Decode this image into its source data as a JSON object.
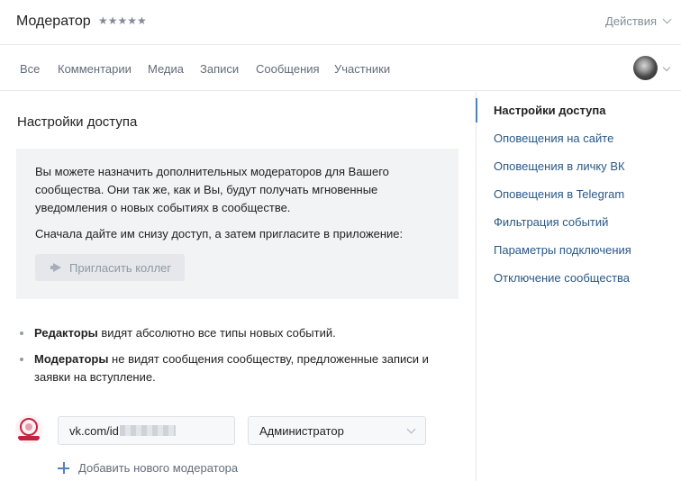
{
  "header": {
    "title": "Модератор",
    "stars": "★★★★★",
    "actions_label": "Действия"
  },
  "tabs": [
    {
      "label": "Все"
    },
    {
      "label": "Комментарии"
    },
    {
      "label": "Медиа"
    },
    {
      "label": "Записи"
    },
    {
      "label": "Сообщения"
    },
    {
      "label": "Участники"
    }
  ],
  "main": {
    "title": "Настройки доступа",
    "info_text": "Вы можете назначить дополнительных модераторов для Вашего сообщества. Они так же, как и Вы, будут получать мгновенные уведомления о новых событиях в сообществе.",
    "info_text2": "Сначала дайте им снизу доступ, а затем пригласите в приложение:",
    "invite_button": "Пригласить коллег",
    "bullets": [
      {
        "bold": "Редакторы",
        "text": " видят абсолютно все типы новых событий."
      },
      {
        "bold": "Модераторы",
        "text": " не видят сообщения сообществу, предложенные записи и заявки на вступление."
      }
    ],
    "moderator_row": {
      "id_value": "vk.com/id",
      "role_value": "Администратор"
    },
    "add_moderator": "Добавить нового модератора"
  },
  "sidebar": {
    "items": [
      {
        "label": "Настройки доступа",
        "active": true
      },
      {
        "label": "Оповещения на сайте"
      },
      {
        "label": "Оповещения в личку ВК"
      },
      {
        "label": "Оповещения в Telegram"
      },
      {
        "label": "Фильтрация событий"
      },
      {
        "label": "Параметры подключения"
      },
      {
        "label": "Отключение сообщества"
      }
    ]
  },
  "colors": {
    "accent": "#5181b8",
    "link": "#2a5885",
    "muted": "#818c99",
    "box_bg": "#f2f3f5"
  }
}
